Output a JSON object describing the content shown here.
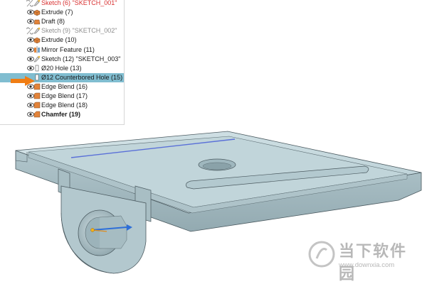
{
  "feature_tree": {
    "items": [
      {
        "label": "Sketch (6) \"SKETCH_001\"",
        "icon": "sketch-icon",
        "state": "sketch-red"
      },
      {
        "label": "Extrude (7)",
        "icon": "extrude-icon",
        "state": "normal"
      },
      {
        "label": "Draft (8)",
        "icon": "draft-icon",
        "state": "normal"
      },
      {
        "label": "Sketch (9) \"SKETCH_002\"",
        "icon": "sketch-icon",
        "state": "suppressed"
      },
      {
        "label": "Extrude (10)",
        "icon": "extrude-icon",
        "state": "normal"
      },
      {
        "label": "Mirror Feature (11)",
        "icon": "mirror-icon",
        "state": "normal"
      },
      {
        "label": "Sketch (12) \"SKETCH_003\"",
        "icon": "sketch-icon",
        "state": "normal"
      },
      {
        "label": "Ø20 Hole (13)",
        "icon": "hole-icon",
        "state": "normal"
      },
      {
        "label": "Ø12 Counterbored Hole (15)",
        "icon": "hole-icon",
        "state": "selected"
      },
      {
        "label": "Edge Blend (16)",
        "icon": "blend-icon",
        "state": "normal"
      },
      {
        "label": "Edge Blend (17)",
        "icon": "blend-icon",
        "state": "normal"
      },
      {
        "label": "Edge Blend (18)",
        "icon": "blend-icon",
        "state": "normal"
      },
      {
        "label": "Chamfer (19)",
        "icon": "chamfer-icon",
        "state": "bold"
      }
    ]
  },
  "colors": {
    "selection": "#80bdd0",
    "pointer_arrow": "#f07d14",
    "part_face": "#c7d9de",
    "part_edge": "#4b5a60",
    "sketch_red": "#d83030"
  },
  "watermark": {
    "title": "当下软件园",
    "url": "www.downxia.com"
  }
}
